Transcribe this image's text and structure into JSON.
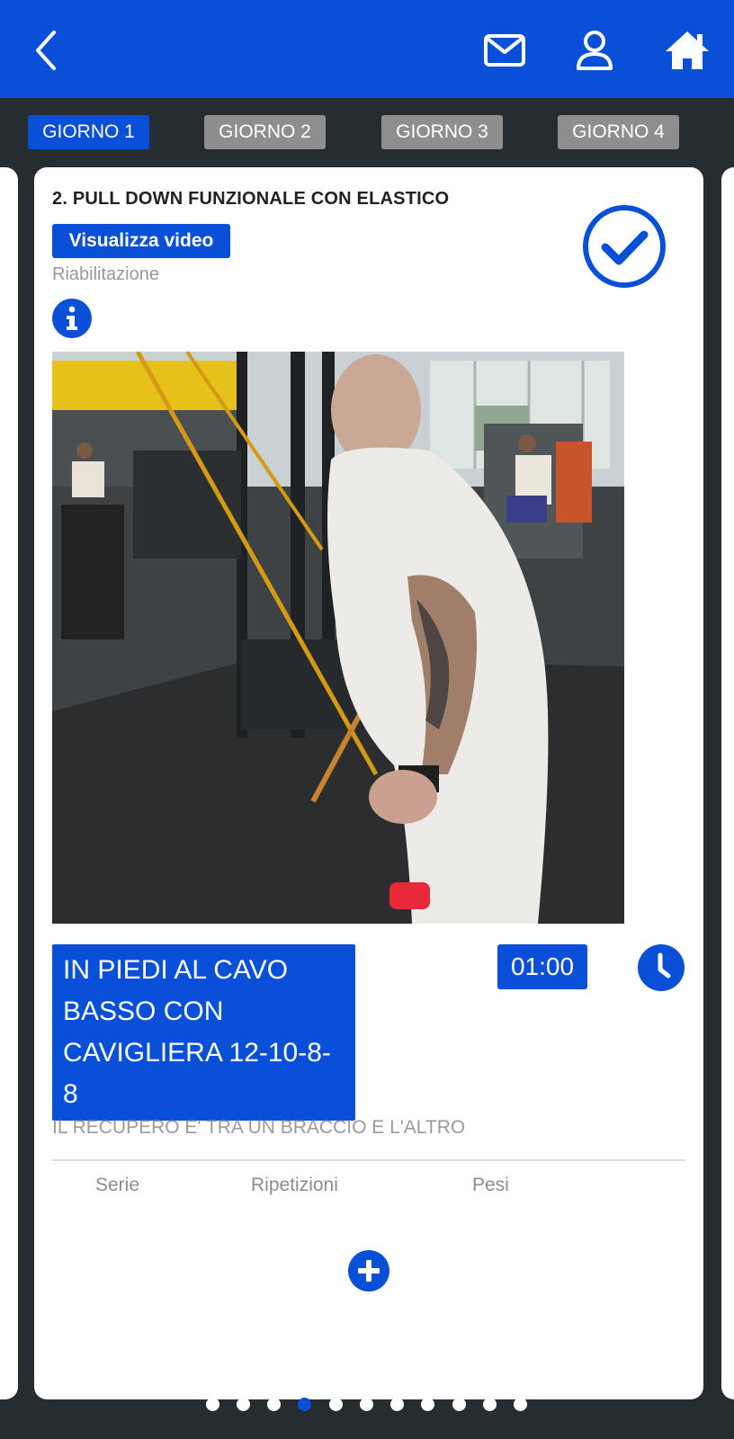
{
  "navbar": {
    "back_icon": "chevron-left-icon",
    "mail_icon": "envelope-icon",
    "user_icon": "user-icon",
    "home_icon": "home-icon",
    "color": "#0a4fd8"
  },
  "tabs": [
    {
      "label": "GIORNO 1",
      "active": true
    },
    {
      "label": "GIORNO 2",
      "active": false
    },
    {
      "label": "GIORNO 3",
      "active": false
    },
    {
      "label": "GIORNO 4",
      "active": false
    }
  ],
  "exercise": {
    "title": "2. PULL DOWN FUNZIONALE CON ELASTICO",
    "video_button": "Visualizza video",
    "category": "Riabilitazione",
    "completed": true,
    "description": [
      "IN PIEDI AL CAVO",
      "BASSO CON",
      "CAVIGLIERA 12-10-8-",
      "8"
    ],
    "rest_time": "01:00",
    "note": "IL RECUPERO E' TRA UN BRACCIO E L'ALTRO"
  },
  "table": {
    "headers": [
      "Serie",
      "Ripetizioni",
      "Pesi"
    ]
  },
  "pagination": {
    "total": 11,
    "active_index": 3
  },
  "colors": {
    "primary": "#0a4fd8",
    "inactive_tab": "#8e8e8e",
    "background": "#262d31"
  }
}
